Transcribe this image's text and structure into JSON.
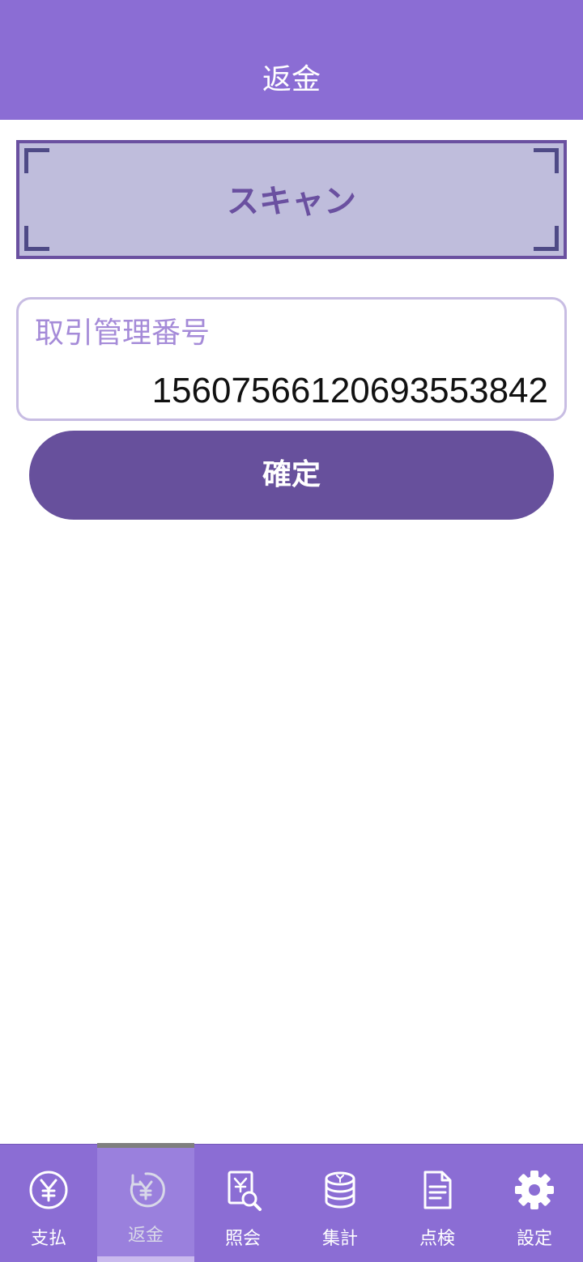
{
  "header": {
    "title": "返金"
  },
  "scan": {
    "label": "スキャン"
  },
  "transaction_field": {
    "label": "取引管理番号",
    "value": "15607566120693553842"
  },
  "confirm": {
    "label": "確定"
  },
  "tabs": [
    {
      "label": "支払",
      "icon": "yen-circle-icon",
      "active": false
    },
    {
      "label": "返金",
      "icon": "yen-refund-icon",
      "active": true
    },
    {
      "label": "照会",
      "icon": "document-search-icon",
      "active": false
    },
    {
      "label": "集計",
      "icon": "coin-stack-icon",
      "active": false
    },
    {
      "label": "点検",
      "icon": "checklist-document-icon",
      "active": false
    },
    {
      "label": "設定",
      "icon": "gear-icon",
      "active": false
    }
  ],
  "colors": {
    "brand": "#8b6dd4",
    "button": "#67509c",
    "scan_background": "#bfbddc",
    "field_label": "#a58bd8"
  }
}
